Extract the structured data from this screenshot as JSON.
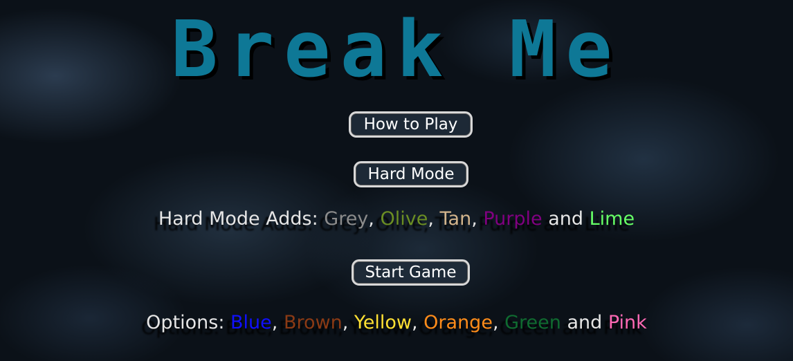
{
  "title": "Break Me",
  "buttons": {
    "how_to_play": "How to Play",
    "hard_mode": "Hard Mode",
    "start_game": "Start Game"
  },
  "hard_mode_info": {
    "prefix": "Hard Mode Adds: ",
    "colors": [
      {
        "name": "Grey",
        "color": "#8c8c8c"
      },
      {
        "name": "Olive",
        "color": "#6b8e23"
      },
      {
        "name": "Tan",
        "color": "#d2b48c"
      },
      {
        "name": "Purple",
        "color": "#800080"
      }
    ],
    "conjunction": "and",
    "last_color": {
      "name": "Lime",
      "color": "#66ff66"
    }
  },
  "options_info": {
    "prefix": "Options: ",
    "colors": [
      {
        "name": "Blue",
        "color": "#1010ff"
      },
      {
        "name": "Brown",
        "color": "#8b3a14"
      },
      {
        "name": "Yellow",
        "color": "#ffe033"
      },
      {
        "name": "Orange",
        "color": "#ff8c1a"
      },
      {
        "name": "Green",
        "color": "#0f6b30"
      }
    ],
    "conjunction": "and",
    "last_color": {
      "name": "Pink",
      "color": "#ff69b4"
    }
  },
  "colors": {
    "title": "#0e7896",
    "title_shadow": "#000000",
    "button_border": "#d8d8d8",
    "text": "#e6e6e6"
  }
}
